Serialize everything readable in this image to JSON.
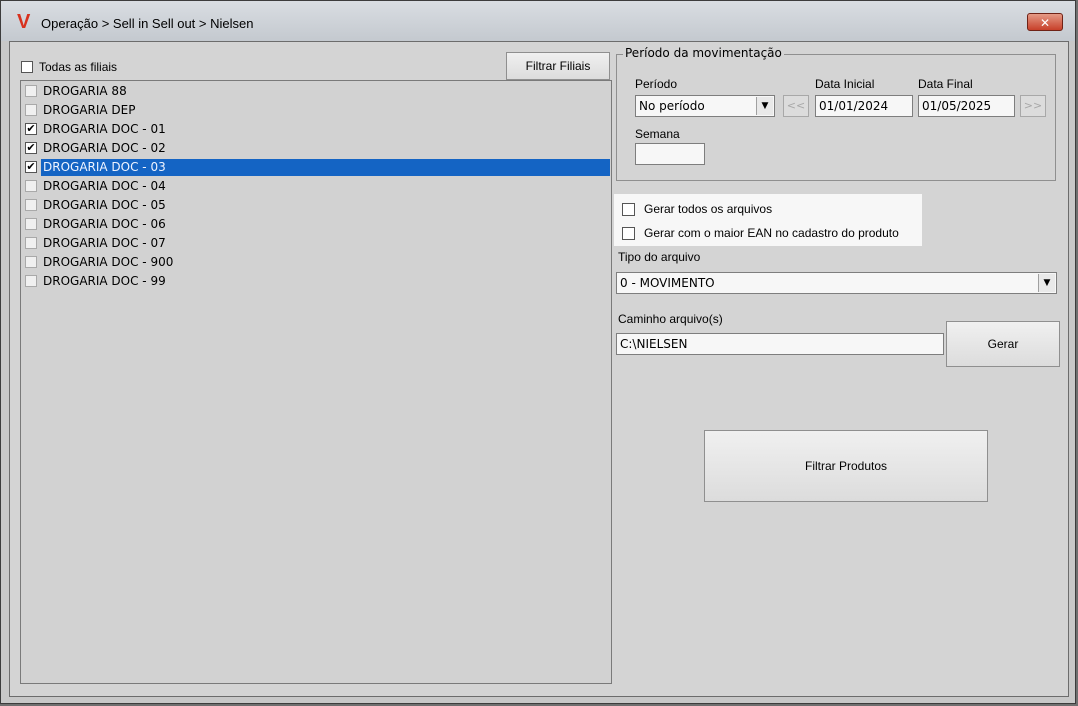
{
  "window": {
    "logo_text": "V",
    "title": "Operação > Sell in Sell out > Nielsen",
    "close_label": "✕"
  },
  "branches": {
    "all_label": "Todas as filiais",
    "filter_button": "Filtrar Filiais",
    "items": [
      {
        "label": "DROGARIA 88",
        "checked": false,
        "selected": false
      },
      {
        "label": "DROGARIA DEP",
        "checked": false,
        "selected": false
      },
      {
        "label": "DROGARIA DOC - 01",
        "checked": true,
        "selected": false
      },
      {
        "label": "DROGARIA DOC - 02",
        "checked": true,
        "selected": false
      },
      {
        "label": "DROGARIA DOC - 03",
        "checked": true,
        "selected": true
      },
      {
        "label": "DROGARIA DOC - 04",
        "checked": false,
        "selected": false
      },
      {
        "label": "DROGARIA DOC - 05",
        "checked": false,
        "selected": false
      },
      {
        "label": "DROGARIA DOC - 06",
        "checked": false,
        "selected": false
      },
      {
        "label": "DROGARIA DOC - 07",
        "checked": false,
        "selected": false
      },
      {
        "label": "DROGARIA DOC - 900",
        "checked": false,
        "selected": false
      },
      {
        "label": "DROGARIA DOC - 99",
        "checked": false,
        "selected": false
      }
    ]
  },
  "period": {
    "group_title": "Período da movimentação",
    "period_label": "Período",
    "period_value": "No período",
    "start_label": "Data Inicial",
    "start_value": "01/01/2024",
    "end_label": "Data Final",
    "end_value": "01/05/2025",
    "prev_label": "<<",
    "next_label": ">>",
    "week_label": "Semana",
    "week_value": ""
  },
  "options": {
    "all_files": "Gerar todos os arquivos",
    "largest_ean": "Gerar com o maior EAN no cadastro do produto"
  },
  "file_type": {
    "label": "Tipo do arquivo",
    "value": "0 - MOVIMENTO"
  },
  "path": {
    "label": "Caminho arquivo(s)",
    "value": "C:\\NIELSEN"
  },
  "actions": {
    "generate": "Gerar",
    "filter_products": "Filtrar Produtos"
  }
}
